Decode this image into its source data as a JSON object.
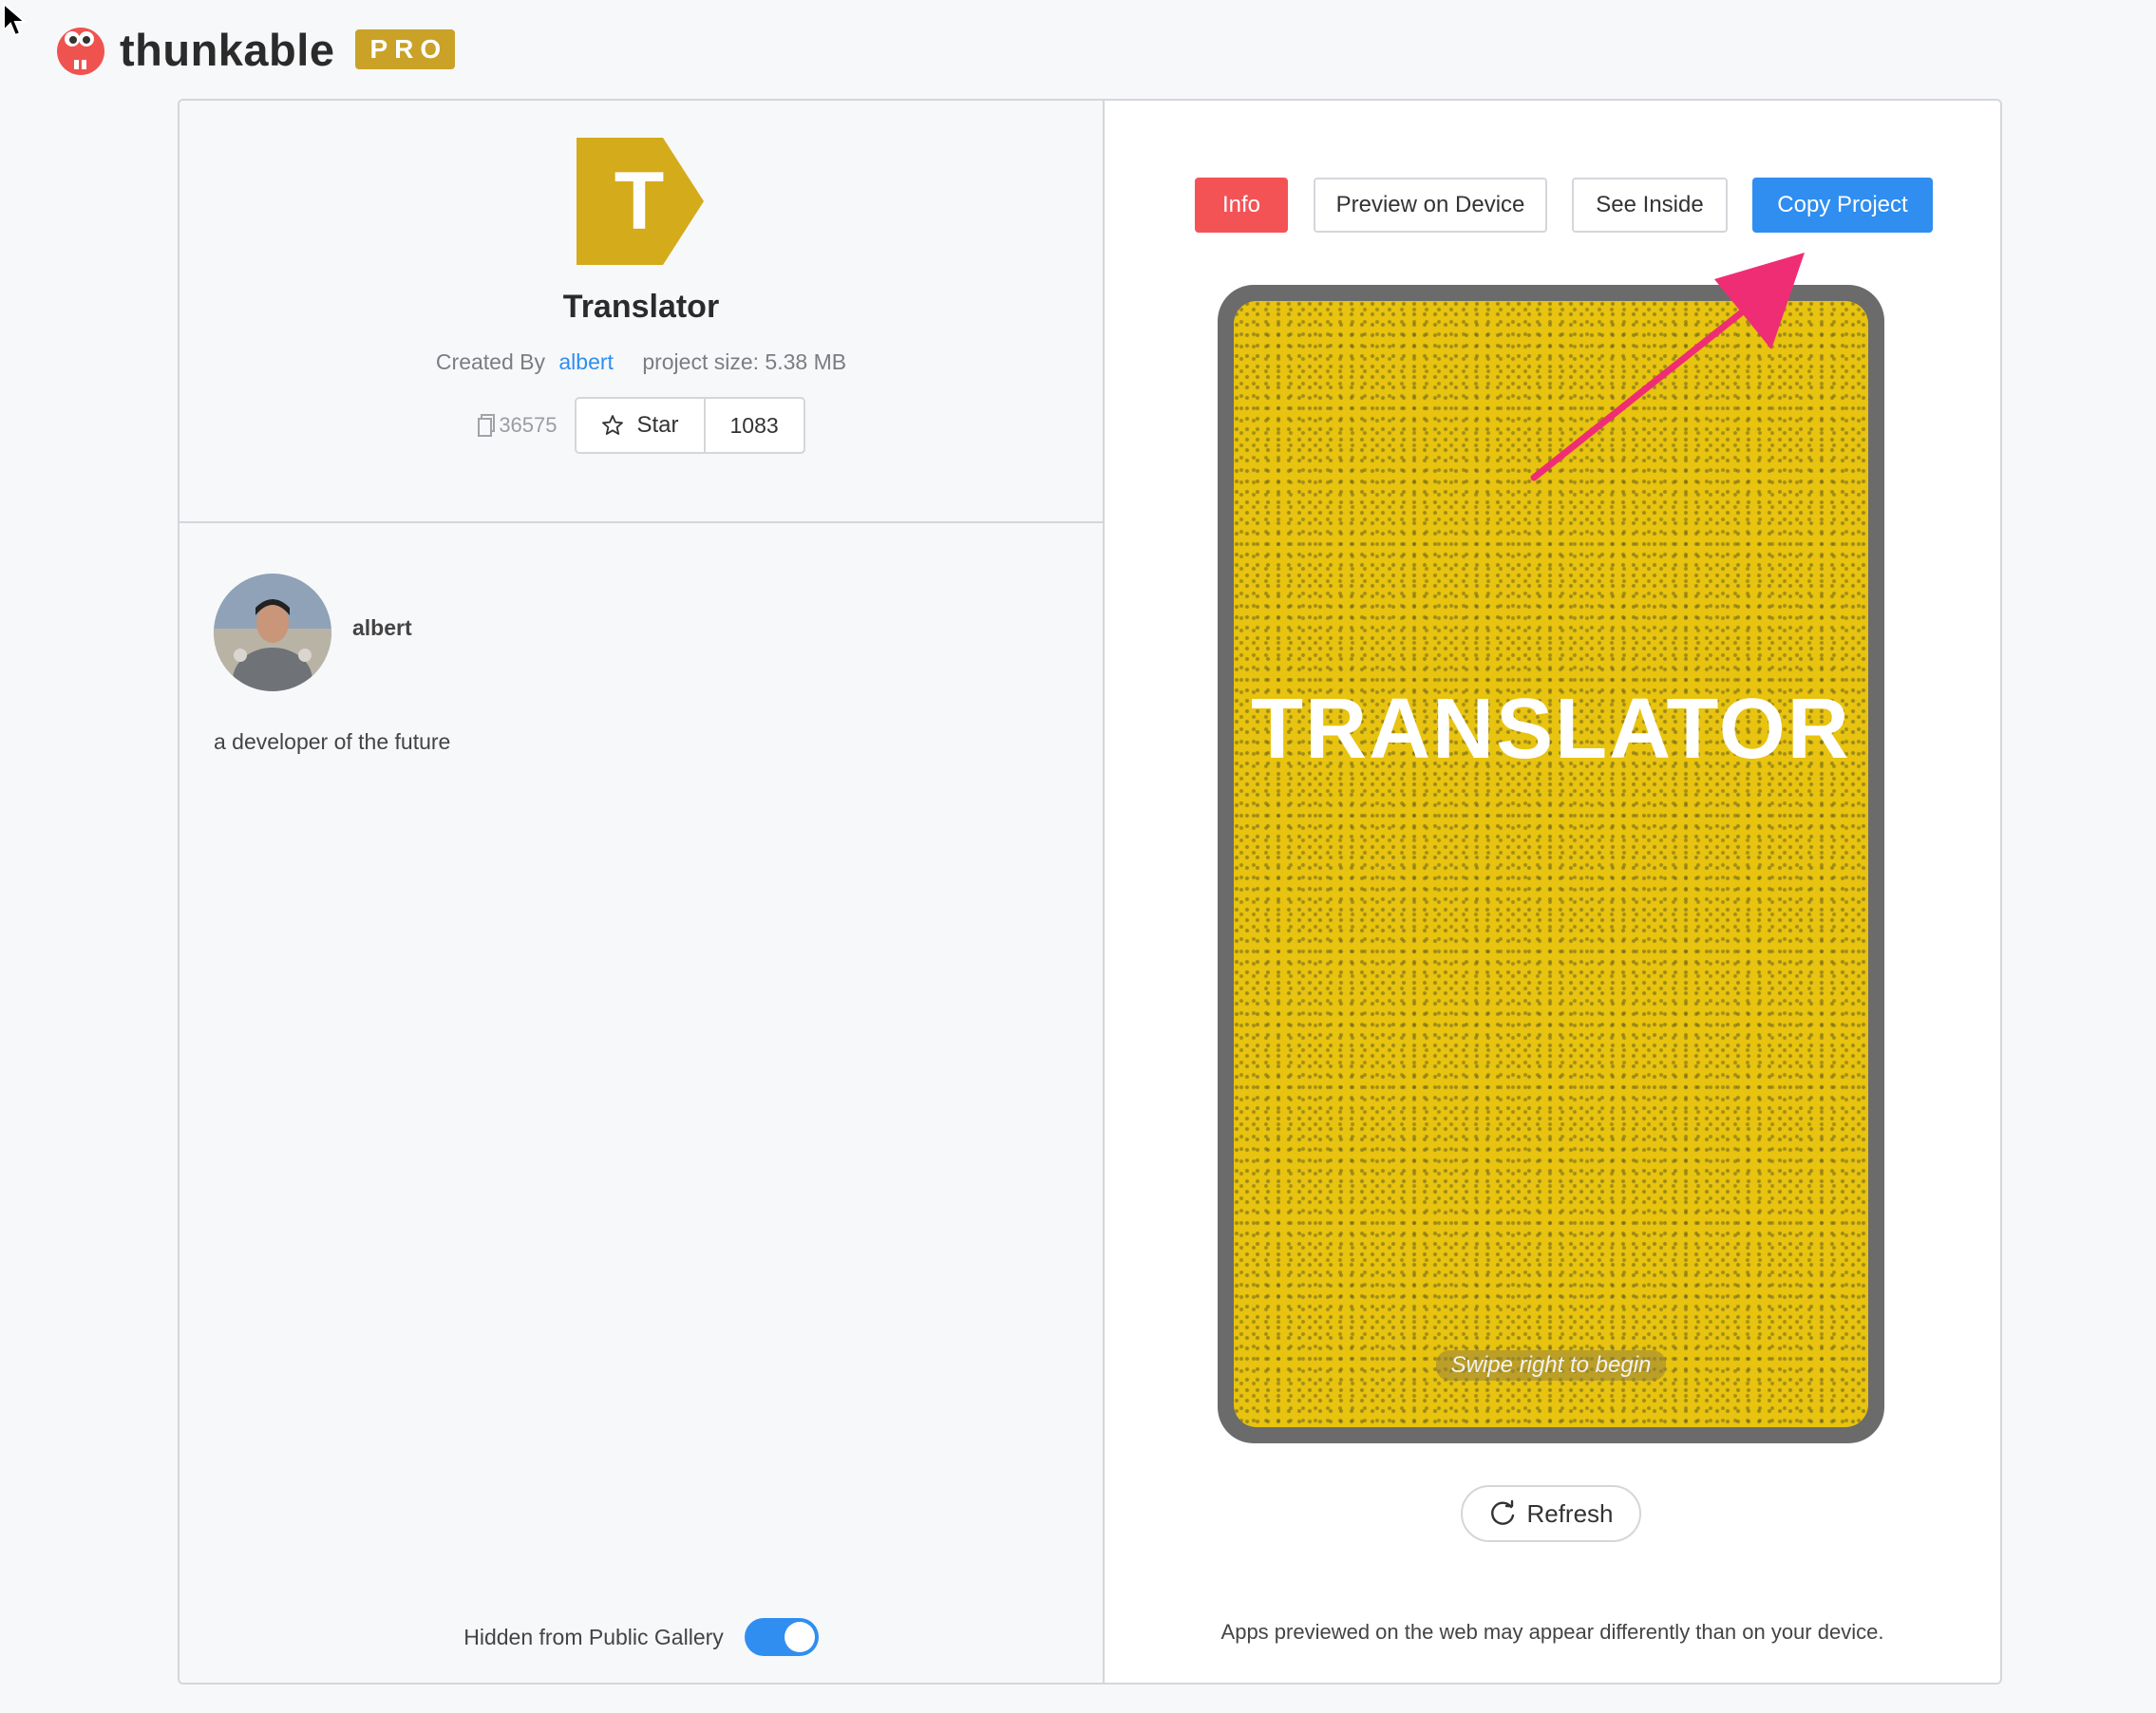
{
  "header": {
    "brand": "thunkable",
    "badge": "PRO"
  },
  "project": {
    "icon_letter": "T",
    "title": "Translator",
    "created_by_label": "Created By",
    "author": "albert",
    "project_size": "project size: 5.38 MB",
    "copies": "36575",
    "star_label": "Star",
    "star_count": "1083"
  },
  "profile": {
    "name": "albert",
    "bio": "a developer of the future"
  },
  "gallery": {
    "hidden_label": "Hidden from Public Gallery",
    "hidden": true
  },
  "actions": {
    "info": "Info",
    "preview": "Preview on Device",
    "see_inside": "See Inside",
    "copy": "Copy Project"
  },
  "preview": {
    "screen_title": "TRANSLATOR",
    "screen_hint": "Swipe right to begin",
    "refresh_label": "Refresh",
    "disclaimer": "Apps previewed on the web may appear differently than on your device."
  },
  "colors": {
    "accent_blue": "#2f8ef0",
    "info_red": "#f45356",
    "pro_gold": "#c9a227",
    "annotation_pink": "#ef2d74"
  },
  "icons": [
    "mouse-cursor-icon",
    "thunkable-logo-icon",
    "copy-icon",
    "star-icon",
    "refresh-icon",
    "annotation-arrow-icon"
  ]
}
